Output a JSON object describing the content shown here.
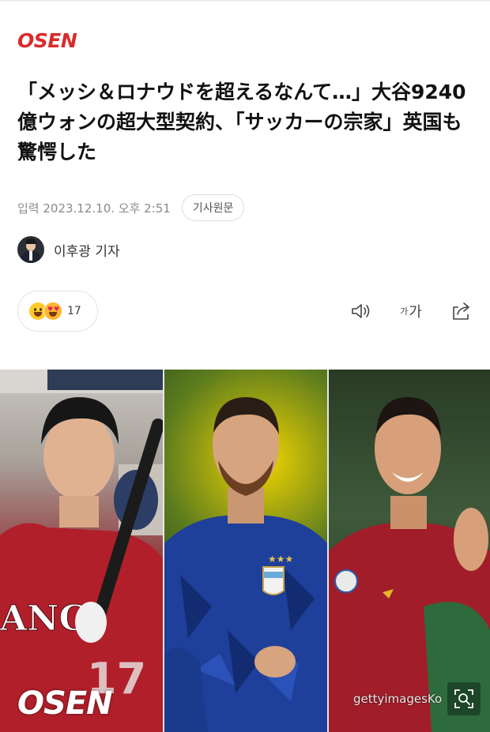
{
  "brand": {
    "logo_text": "OSEN",
    "accent_color": "#d92b2b"
  },
  "article": {
    "title": "「メッシ＆ロナウドを超えるなんて…」大谷9240 億ウォンの超大型契約、「サッカーの宗家」英国も驚愕した",
    "date_label": "입력 2023.12.10. 오후 2:51",
    "original_button": "기사원문",
    "author": {
      "name": "이후광 기자",
      "avatar_icon": "reporter-avatar"
    }
  },
  "toolbar": {
    "reaction_icons": [
      "smile-emoji-icon",
      "heart-eyes-emoji-icon"
    ],
    "reaction_count": "17",
    "audio_icon": "speaker-icon",
    "font_size_label_small": "가",
    "font_size_label_large": "가",
    "share_icon": "share-icon"
  },
  "photo": {
    "watermark_left": "OSEN",
    "watermark_right": "gettyimagesKo",
    "zoom_icon": "zoom-icon",
    "panels": [
      "baseball-player",
      "soccer-player-argentina",
      "soccer-player-portugal"
    ]
  }
}
